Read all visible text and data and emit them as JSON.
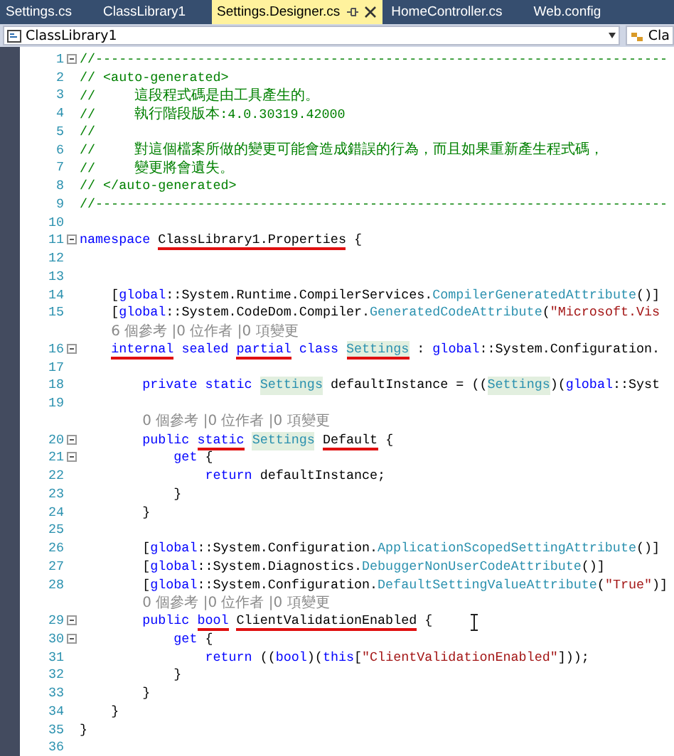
{
  "tabs": [
    {
      "label": "Settings.cs",
      "selected": false
    },
    {
      "label": "ClassLibrary1",
      "selected": false
    },
    {
      "label": "Settings.Designer.cs",
      "selected": true
    },
    {
      "label": "HomeController.cs",
      "selected": false
    },
    {
      "label": "Web.config",
      "selected": false
    }
  ],
  "navigation": {
    "project": "ClassLibrary1",
    "member": "Cla"
  },
  "lines": [
    {
      "kind": "code",
      "number": "1",
      "fold": true,
      "tokens": [
        {
          "text": "//-------------------------------------------------------------------------",
          "kind": "comment",
          "underlined": false
        }
      ]
    },
    {
      "kind": "code",
      "number": "2",
      "fold": false,
      "tokens": [
        {
          "text": "// <auto-generated>",
          "kind": "comment",
          "underlined": false
        }
      ]
    },
    {
      "kind": "code",
      "number": "3",
      "fold": false,
      "tokens": [
        {
          "text": "//     這段程式碼是由工具產生的。",
          "kind": "comment",
          "underlined": false
        }
      ]
    },
    {
      "kind": "code",
      "number": "4",
      "fold": false,
      "tokens": [
        {
          "text": "//     執行階段版本:4.0.30319.42000",
          "kind": "comment",
          "underlined": false
        }
      ]
    },
    {
      "kind": "code",
      "number": "5",
      "fold": false,
      "tokens": [
        {
          "text": "//",
          "kind": "comment",
          "underlined": false
        }
      ]
    },
    {
      "kind": "code",
      "number": "6",
      "fold": false,
      "tokens": [
        {
          "text": "//     對這個檔案所做的變更可能會造成錯誤的行為，而且如果重新產生程式碼，",
          "kind": "comment",
          "underlined": false
        }
      ]
    },
    {
      "kind": "code",
      "number": "7",
      "fold": false,
      "tokens": [
        {
          "text": "//     變更將會遺失。",
          "kind": "comment",
          "underlined": false
        }
      ]
    },
    {
      "kind": "code",
      "number": "8",
      "fold": false,
      "tokens": [
        {
          "text": "// </auto-generated>",
          "kind": "comment",
          "underlined": false
        }
      ]
    },
    {
      "kind": "code",
      "number": "9",
      "fold": false,
      "tokens": [
        {
          "text": "//-------------------------------------------------------------------------",
          "kind": "comment",
          "underlined": false
        }
      ]
    },
    {
      "kind": "code",
      "number": "10",
      "fold": false
    },
    {
      "kind": "code",
      "number": "11",
      "fold": true,
      "tokens": [
        {
          "text": "namespace",
          "kind": "keyword",
          "underlined": false
        },
        {
          "text": " ClassLibrary1.Properties",
          "kind": "plain",
          "underlined": true
        },
        {
          "text": " {",
          "kind": "plain",
          "underlined": false
        }
      ]
    },
    {
      "kind": "code",
      "number": "12",
      "fold": false
    },
    {
      "kind": "code",
      "number": "13",
      "fold": false
    },
    {
      "kind": "code",
      "number": "14",
      "fold": false,
      "tokens": [
        {
          "text": "    [",
          "kind": "plain",
          "underlined": false
        },
        {
          "text": "global",
          "kind": "keyword",
          "underlined": false
        },
        {
          "text": "::System.Runtime.CompilerServices.",
          "kind": "plain",
          "underlined": false
        },
        {
          "text": "CompilerGeneratedAttribute",
          "kind": "type",
          "underlined": false
        },
        {
          "text": "()]",
          "kind": "plain",
          "underlined": false
        }
      ]
    },
    {
      "kind": "code",
      "number": "15",
      "fold": false,
      "tokens": [
        {
          "text": "    [",
          "kind": "plain",
          "underlined": false
        },
        {
          "text": "global",
          "kind": "keyword",
          "underlined": false
        },
        {
          "text": "::System.CodeDom.Compiler.",
          "kind": "plain",
          "underlined": false
        },
        {
          "text": "GeneratedCodeAttribute",
          "kind": "type",
          "underlined": false
        },
        {
          "text": "(",
          "kind": "plain",
          "underlined": false
        },
        {
          "text": "\"Microsoft.Vis",
          "kind": "string",
          "underlined": false
        }
      ]
    },
    {
      "kind": "lens",
      "text": "6 個參考 |0 位作者 |0 項變更"
    },
    {
      "kind": "code",
      "number": "16",
      "fold": true,
      "tokens": [
        {
          "text": "    internal",
          "kind": "keyword",
          "underlined": true
        },
        {
          "text": " sealed",
          "kind": "keyword",
          "underlined": false
        },
        {
          "text": " partial",
          "kind": "keyword",
          "underlined": true
        },
        {
          "text": " class",
          "kind": "keyword",
          "underlined": false
        },
        {
          "text": " Settings",
          "kind": "highlight",
          "underlined": true
        },
        {
          "text": " : ",
          "kind": "plain",
          "underlined": false
        },
        {
          "text": "global",
          "kind": "keyword",
          "underlined": false
        },
        {
          "text": "::System.Configuration.",
          "kind": "plain",
          "underlined": false
        }
      ]
    },
    {
      "kind": "code",
      "number": "17",
      "fold": false
    },
    {
      "kind": "code",
      "number": "18",
      "fold": false,
      "tokens": [
        {
          "text": "        private",
          "kind": "keyword",
          "underlined": false
        },
        {
          "text": " static",
          "kind": "keyword",
          "underlined": false
        },
        {
          "text": " Settings",
          "kind": "highlight",
          "underlined": false
        },
        {
          "text": " defaultInstance = ((",
          "kind": "plain",
          "underlined": false
        },
        {
          "text": "Settings",
          "kind": "highlight",
          "underlined": false
        },
        {
          "text": ")(",
          "kind": "plain",
          "underlined": false
        },
        {
          "text": "global",
          "kind": "keyword",
          "underlined": false
        },
        {
          "text": "::Syst",
          "kind": "plain",
          "underlined": false
        }
      ]
    },
    {
      "kind": "code",
      "number": "19",
      "fold": false
    },
    {
      "kind": "lens",
      "text": "0 個參考 |0 位作者 |0 項變更"
    },
    {
      "kind": "code",
      "number": "20",
      "fold": true,
      "tokens": [
        {
          "text": "        public",
          "kind": "keyword",
          "underlined": false
        },
        {
          "text": " static",
          "kind": "keyword",
          "underlined": true
        },
        {
          "text": " Settings",
          "kind": "highlight",
          "underlined": false
        },
        {
          "text": " Default",
          "kind": "plain",
          "underlined": true
        },
        {
          "text": " {",
          "kind": "plain",
          "underlined": false
        }
      ]
    },
    {
      "kind": "code",
      "number": "21",
      "fold": true,
      "tokens": [
        {
          "text": "            get",
          "kind": "keyword",
          "underlined": false
        },
        {
          "text": " {",
          "kind": "plain",
          "underlined": false
        }
      ]
    },
    {
      "kind": "code",
      "number": "22",
      "fold": false,
      "tokens": [
        {
          "text": "                return",
          "kind": "keyword",
          "underlined": false
        },
        {
          "text": " defaultInstance;",
          "kind": "plain",
          "underlined": false
        }
      ]
    },
    {
      "kind": "code",
      "number": "23",
      "fold": false,
      "tokens": [
        {
          "text": "            }",
          "kind": "plain",
          "underlined": false
        }
      ]
    },
    {
      "kind": "code",
      "number": "24",
      "fold": false,
      "tokens": [
        {
          "text": "        }",
          "kind": "plain",
          "underlined": false
        }
      ]
    },
    {
      "kind": "code",
      "number": "25",
      "fold": false
    },
    {
      "kind": "code",
      "number": "26",
      "fold": false,
      "tokens": [
        {
          "text": "        [",
          "kind": "plain",
          "underlined": false
        },
        {
          "text": "global",
          "kind": "keyword",
          "underlined": false
        },
        {
          "text": "::System.Configuration.",
          "kind": "plain",
          "underlined": false
        },
        {
          "text": "ApplicationScopedSettingAttribute",
          "kind": "type",
          "underlined": false
        },
        {
          "text": "()]",
          "kind": "plain",
          "underlined": false
        }
      ]
    },
    {
      "kind": "code",
      "number": "27",
      "fold": false,
      "tokens": [
        {
          "text": "        [",
          "kind": "plain",
          "underlined": false
        },
        {
          "text": "global",
          "kind": "keyword",
          "underlined": false
        },
        {
          "text": "::System.Diagnostics.",
          "kind": "plain",
          "underlined": false
        },
        {
          "text": "DebuggerNonUserCodeAttribute",
          "kind": "type",
          "underlined": false
        },
        {
          "text": "()]",
          "kind": "plain",
          "underlined": false
        }
      ]
    },
    {
      "kind": "code",
      "number": "28",
      "fold": false,
      "tokens": [
        {
          "text": "        [",
          "kind": "plain",
          "underlined": false
        },
        {
          "text": "global",
          "kind": "keyword",
          "underlined": false
        },
        {
          "text": "::System.Configuration.",
          "kind": "plain",
          "underlined": false
        },
        {
          "text": "DefaultSettingValueAttribute",
          "kind": "type",
          "underlined": false
        },
        {
          "text": "(",
          "kind": "plain",
          "underlined": false
        },
        {
          "text": "\"True\"",
          "kind": "string",
          "underlined": false
        },
        {
          "text": ")]",
          "kind": "plain",
          "underlined": false
        }
      ]
    },
    {
      "kind": "lens",
      "text": "0 個參考 |0 位作者 |0 項變更"
    },
    {
      "kind": "code",
      "number": "29",
      "fold": true,
      "tokens": [
        {
          "text": "        public",
          "kind": "keyword",
          "underlined": false
        },
        {
          "text": " bool",
          "kind": "keyword",
          "underlined": true
        },
        {
          "text": " ClientValidationEnabled",
          "kind": "plain",
          "underlined": true
        },
        {
          "text": " {",
          "kind": "plain",
          "underlined": false
        }
      ]
    },
    {
      "kind": "code",
      "number": "30",
      "fold": true,
      "tokens": [
        {
          "text": "            get",
          "kind": "keyword",
          "underlined": false
        },
        {
          "text": " {",
          "kind": "plain",
          "underlined": false
        }
      ]
    },
    {
      "kind": "code",
      "number": "31",
      "fold": false,
      "tokens": [
        {
          "text": "                return",
          "kind": "keyword",
          "underlined": false
        },
        {
          "text": " ((",
          "kind": "plain",
          "underlined": false
        },
        {
          "text": "bool",
          "kind": "keyword",
          "underlined": false
        },
        {
          "text": ")(",
          "kind": "plain",
          "underlined": false
        },
        {
          "text": "this",
          "kind": "keyword",
          "underlined": false
        },
        {
          "text": "[",
          "kind": "plain",
          "underlined": false
        },
        {
          "text": "\"ClientValidationEnabled\"",
          "kind": "string",
          "underlined": false
        },
        {
          "text": "]));",
          "kind": "plain",
          "underlined": false
        }
      ]
    },
    {
      "kind": "code",
      "number": "32",
      "fold": false,
      "tokens": [
        {
          "text": "            }",
          "kind": "plain",
          "underlined": false
        }
      ]
    },
    {
      "kind": "code",
      "number": "33",
      "fold": false,
      "tokens": [
        {
          "text": "        }",
          "kind": "plain",
          "underlined": false
        }
      ]
    },
    {
      "kind": "code",
      "number": "34",
      "fold": false,
      "tokens": [
        {
          "text": "    }",
          "kind": "plain",
          "underlined": false
        }
      ]
    },
    {
      "kind": "code",
      "number": "35",
      "fold": false,
      "tokens": [
        {
          "text": "}",
          "kind": "plain",
          "underlined": false
        }
      ]
    },
    {
      "kind": "code",
      "number": "36",
      "fold": false
    }
  ]
}
